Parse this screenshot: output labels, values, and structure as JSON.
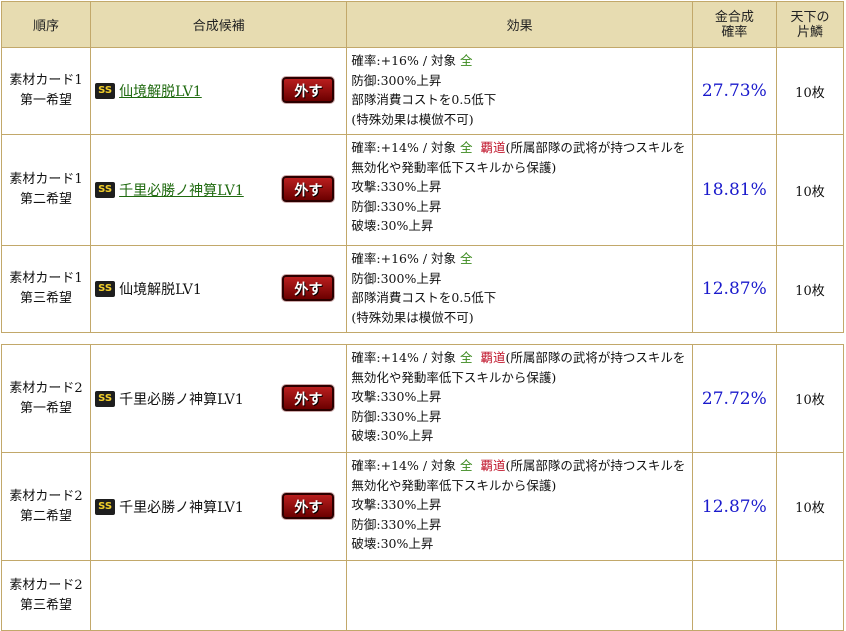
{
  "headers": {
    "order": "順序",
    "candidate": "合成候補",
    "effect": "効果",
    "rate": [
      "金合成",
      "確率"
    ],
    "scale": [
      "天下の",
      "片鱗"
    ]
  },
  "badge": "SS",
  "remove_label": "外す",
  "group1": [
    {
      "order": [
        "素材カード1",
        "第一希望"
      ],
      "name": "仙境解脱LV1",
      "linked": true,
      "rate": "27.73%",
      "scale": "10枚",
      "effect": {
        "rate_line": "確率:+16%  /  対象  ",
        "target": "全",
        "lines": [
          "防御:300%上昇",
          "部隊消費コストを0.5低下",
          "(特殊効果は模倣不可)"
        ]
      }
    },
    {
      "order": [
        "素材カード1",
        "第二希望"
      ],
      "name": "千里必勝ノ神算LV1",
      "linked": true,
      "rate": "18.81%",
      "scale": "10枚",
      "effect": {
        "rate_line": "確率:+14%  /  対象  ",
        "target": "全",
        "special": "覇道",
        "special_desc": "(所属部隊の武将が持つスキルを無効化や発動率低下スキルから保護)",
        "lines": [
          "攻撃:330%上昇",
          "防御:330%上昇",
          "破壊:30%上昇"
        ]
      }
    },
    {
      "order": [
        "素材カード1",
        "第三希望"
      ],
      "name": "仙境解脱LV1",
      "linked": false,
      "rate": "12.87%",
      "scale": "10枚",
      "effect": {
        "rate_line": "確率:+16%  /  対象  ",
        "target": "全",
        "lines": [
          "防御:300%上昇",
          "部隊消費コストを0.5低下",
          "(特殊効果は模倣不可)"
        ]
      }
    }
  ],
  "group2": [
    {
      "order": [
        "素材カード2",
        "第一希望"
      ],
      "name": "千里必勝ノ神算LV1",
      "linked": false,
      "rate": "27.72%",
      "scale": "10枚",
      "effect": {
        "rate_line": "確率:+14%  /  対象  ",
        "target": "全",
        "special": "覇道",
        "special_desc": "(所属部隊の武将が持つスキルを無効化や発動率低下スキルから保護)",
        "lines": [
          "攻撃:330%上昇",
          "防御:330%上昇",
          "破壊:30%上昇"
        ]
      }
    },
    {
      "order": [
        "素材カード2",
        "第二希望"
      ],
      "name": "千里必勝ノ神算LV1",
      "linked": false,
      "rate": "12.87%",
      "scale": "10枚",
      "effect": {
        "rate_line": "確率:+14%  /  対象  ",
        "target": "全",
        "special": "覇道",
        "special_desc": "(所属部隊の武将が持つスキルを無効化や発動率低下スキルから保護)",
        "lines": [
          "攻撃:330%上昇",
          "防御:330%上昇",
          "破壊:30%上昇"
        ]
      }
    },
    {
      "order": [
        "素材カード2",
        "第三希望"
      ]
    }
  ],
  "colors": {
    "header_bg": "#e7dcb1",
    "border": "#c2a86a",
    "rate": "#1a1acc",
    "link": "#1f6a0f",
    "target_green": "#3d8b20",
    "special_red": "#c0152b"
  }
}
